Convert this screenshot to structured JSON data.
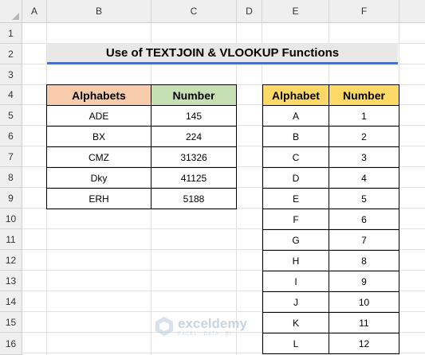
{
  "columns": [
    "A",
    "B",
    "C",
    "D",
    "E",
    "F"
  ],
  "rows": [
    "1",
    "2",
    "3",
    "4",
    "5",
    "6",
    "7",
    "8",
    "9",
    "10",
    "11",
    "12",
    "13",
    "14",
    "15",
    "16"
  ],
  "title": "Use of TEXTJOIN & VLOOKUP Functions",
  "table1": {
    "headers": [
      "Alphabets",
      "Number"
    ],
    "rows": [
      [
        "ADE",
        "145"
      ],
      [
        "BX",
        "224"
      ],
      [
        "CMZ",
        "31326"
      ],
      [
        "Dky",
        "41125"
      ],
      [
        "ERH",
        "5188"
      ]
    ]
  },
  "table2": {
    "headers": [
      "Alphabet",
      "Number"
    ],
    "rows": [
      [
        "A",
        "1"
      ],
      [
        "B",
        "2"
      ],
      [
        "C",
        "3"
      ],
      [
        "D",
        "4"
      ],
      [
        "E",
        "5"
      ],
      [
        "F",
        "6"
      ],
      [
        "G",
        "7"
      ],
      [
        "H",
        "8"
      ],
      [
        "I",
        "9"
      ],
      [
        "J",
        "10"
      ],
      [
        "K",
        "11"
      ],
      [
        "L",
        "12"
      ]
    ]
  },
  "watermark": {
    "name": "exceldemy",
    "tagline": "EXCEL · DATA · BI"
  },
  "colors": {
    "title_underline": "#4472c4",
    "alphabets_header": "#f8cbad",
    "number_header": "#c6e0b4",
    "table2_header": "#ffd966"
  }
}
